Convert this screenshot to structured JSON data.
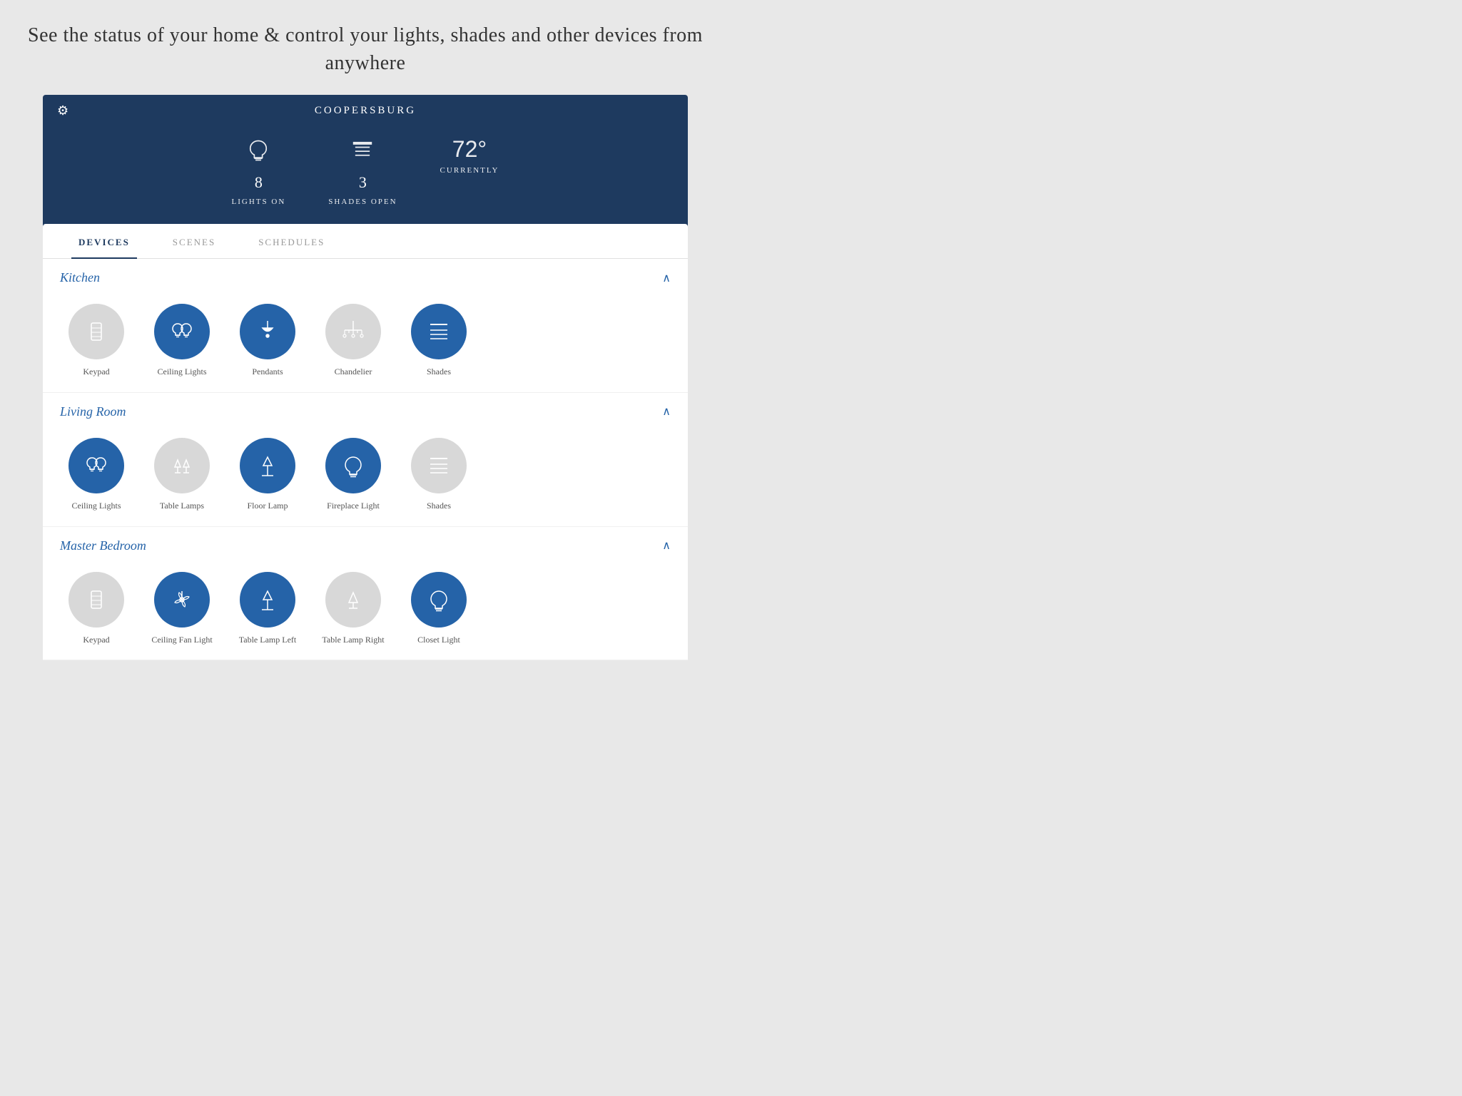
{
  "header": {
    "tagline": "See the status of your home & control your lights, shades and other devices from anywhere"
  },
  "app": {
    "title": "Coopersburg",
    "gear_label": "⚙",
    "status": [
      {
        "id": "lights",
        "icon": "light-bulb",
        "number": "8",
        "text": "Lights On"
      },
      {
        "id": "shades",
        "icon": "shades",
        "number": "3",
        "text": "Shades Open"
      },
      {
        "id": "temp",
        "icon": "temp",
        "number": "72°",
        "text": "Currently"
      }
    ]
  },
  "tabs": [
    {
      "id": "devices",
      "label": "Devices",
      "active": true
    },
    {
      "id": "scenes",
      "label": "Scenes",
      "active": false
    },
    {
      "id": "schedules",
      "label": "Schedules",
      "active": false
    }
  ],
  "sections": [
    {
      "id": "kitchen",
      "title": "Kitchen",
      "expanded": true,
      "devices": [
        {
          "id": "keypad-k",
          "label": "Keypad",
          "icon": "keypad",
          "color": "light-gray"
        },
        {
          "id": "ceiling-lights-k",
          "label": "Ceiling Lights",
          "icon": "bulbs",
          "color": "blue"
        },
        {
          "id": "pendants",
          "label": "Pendants",
          "icon": "pendant",
          "color": "blue"
        },
        {
          "id": "chandelier",
          "label": "Chandelier",
          "icon": "chandelier",
          "color": "light-gray"
        },
        {
          "id": "shades-k",
          "label": "Shades",
          "icon": "shades-device",
          "color": "blue"
        }
      ]
    },
    {
      "id": "living-room",
      "title": "Living Room",
      "expanded": true,
      "devices": [
        {
          "id": "ceiling-lights-lr",
          "label": "Ceiling Lights",
          "icon": "bulbs",
          "color": "blue"
        },
        {
          "id": "table-lamps",
          "label": "Table Lamps",
          "icon": "table-lamps",
          "color": "light-gray"
        },
        {
          "id": "floor-lamp",
          "label": "Floor Lamp",
          "icon": "floor-lamp",
          "color": "blue"
        },
        {
          "id": "fireplace-light",
          "label": "Fireplace Light",
          "icon": "bulb-single",
          "color": "blue"
        },
        {
          "id": "shades-lr",
          "label": "Shades",
          "icon": "shades-device",
          "color": "light-gray"
        }
      ]
    },
    {
      "id": "master-bedroom",
      "title": "Master Bedroom",
      "expanded": true,
      "devices": [
        {
          "id": "keypad-mb",
          "label": "Keypad",
          "icon": "keypad",
          "color": "light-gray"
        },
        {
          "id": "ceiling-fan-light",
          "label": "Ceiling Fan Light",
          "icon": "ceiling-fan",
          "color": "blue"
        },
        {
          "id": "table-lamp-left",
          "label": "Table Lamp Left",
          "icon": "floor-lamp",
          "color": "blue"
        },
        {
          "id": "table-lamp-right",
          "label": "Table Lamp Right",
          "icon": "table-lamp-single",
          "color": "light-gray"
        },
        {
          "id": "closet-light",
          "label": "Closet Light",
          "icon": "bulb-single",
          "color": "blue"
        }
      ]
    }
  ]
}
